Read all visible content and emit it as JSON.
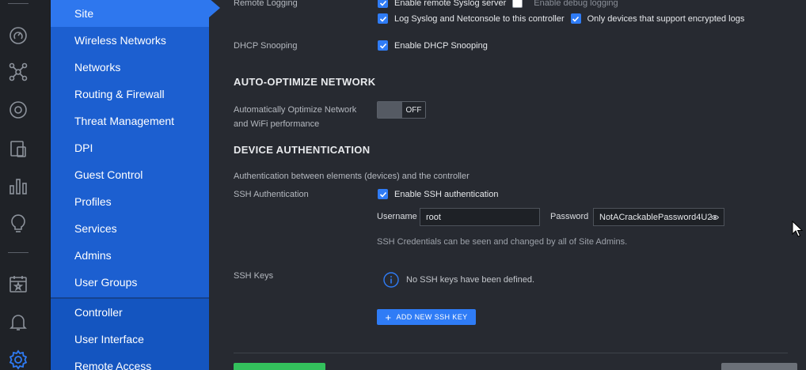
{
  "rail": {
    "icons": [
      "dashboard-icon",
      "topology-icon",
      "devices-icon",
      "clients-icon",
      "statistics-icon",
      "insights-icon",
      "events-icon",
      "alerts-icon",
      "settings-icon"
    ]
  },
  "nav": {
    "items": [
      {
        "label": "Site",
        "active": true
      },
      {
        "label": "Wireless Networks"
      },
      {
        "label": "Networks"
      },
      {
        "label": "Routing & Firewall"
      },
      {
        "label": "Threat Management"
      },
      {
        "label": "DPI"
      },
      {
        "label": "Guest Control"
      },
      {
        "label": "Profiles"
      },
      {
        "label": "Services"
      },
      {
        "label": "Admins"
      },
      {
        "label": "User Groups"
      }
    ],
    "items2": [
      {
        "label": "Controller"
      },
      {
        "label": "User Interface"
      },
      {
        "label": "Remote Access"
      }
    ]
  },
  "remote_logging": {
    "label": "Remote Logging",
    "syslog_label": "Enable remote Syslog server",
    "debug_label": "Enable debug logging",
    "netconsole_label": "Log Syslog and Netconsole to this controller",
    "encrypted_label": "Only devices that support encrypted logs"
  },
  "dhcp": {
    "label": "DHCP Snooping",
    "enable_label": "Enable DHCP Snooping"
  },
  "auto_optimize": {
    "title": "AUTO-OPTIMIZE NETWORK",
    "label_line1": "Automatically Optimize Network",
    "label_line2": "and WiFi performance",
    "toggle_text": "OFF"
  },
  "device_auth": {
    "title": "DEVICE AUTHENTICATION",
    "subtitle": "Authentication between elements (devices) and the controller",
    "ssh_label": "SSH Authentication",
    "ssh_enable_label": "Enable SSH authentication",
    "username_label": "Username",
    "username_value": "root",
    "password_label": "Password",
    "password_value": "NotACrackablePassword4U2",
    "hint": "SSH Credentials can be seen and changed by all of Site Admins.",
    "keys_label": "SSH Keys",
    "no_keys_text": "No SSH keys have been defined.",
    "add_key_label": "ADD NEW SSH KEY"
  },
  "colors": {
    "accent": "#2f7cf6",
    "nav_bg": "#1c5fd0",
    "nav_active": "#2e77ee",
    "apply_button": "#33c15c",
    "background": "#272a31"
  }
}
